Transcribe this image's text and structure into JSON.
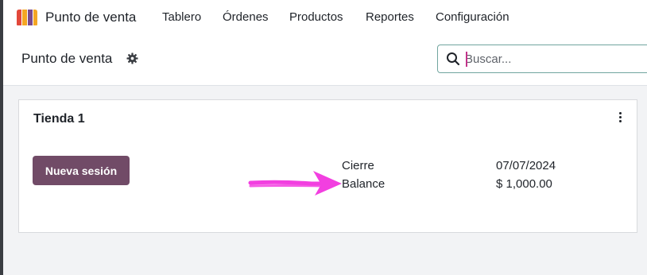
{
  "app": {
    "name": "Punto de venta"
  },
  "nav": {
    "items": [
      {
        "label": "Tablero"
      },
      {
        "label": "Órdenes"
      },
      {
        "label": "Productos"
      },
      {
        "label": "Reportes"
      },
      {
        "label": "Configuración"
      }
    ]
  },
  "control_panel": {
    "breadcrumb": "Punto de venta",
    "search": {
      "placeholder": "Buscar..."
    }
  },
  "card": {
    "title": "Tienda 1",
    "button_label": "Nueva sesión",
    "rows": [
      {
        "label": "Cierre",
        "value": "07/07/2024"
      },
      {
        "label": "Balance",
        "value": "$ 1,000.00"
      }
    ]
  },
  "colors": {
    "primary_button": "#714b67",
    "annotation_arrow": "#f23fe0",
    "search_focus_border": "#71a59f"
  },
  "icons": [
    "app-logo-icon",
    "gear-icon",
    "search-icon",
    "kebab-menu-icon",
    "annotation-arrow"
  ]
}
